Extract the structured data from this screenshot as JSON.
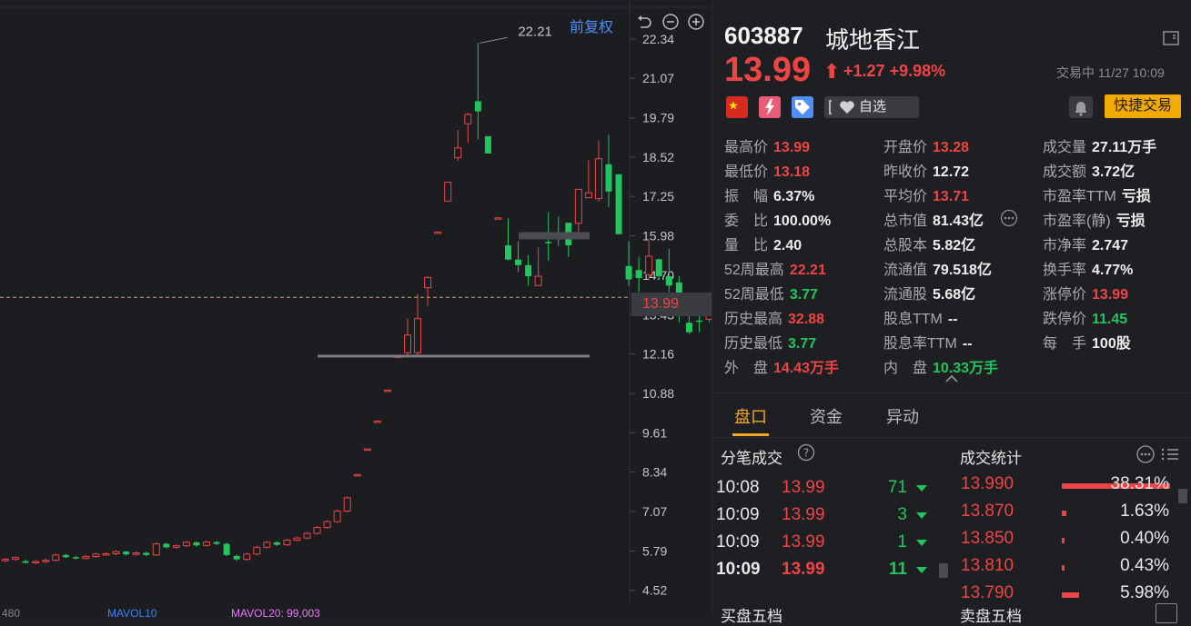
{
  "chart": {
    "adjust_label": "前复权",
    "price_axis": [
      "22.34",
      "21.07",
      "19.79",
      "18.52",
      "17.25",
      "15.98",
      "14.70",
      "13.43",
      "12.16",
      "10.88",
      "9.61",
      "8.34",
      "7.07",
      "5.79",
      "4.52"
    ],
    "annotation_high": "22.21",
    "current_price_tag": "13.99",
    "bottom_legend": {
      "vol": "480",
      "mavol10": "MAVOL10",
      "mavol20": "MAVOL20: 99,003"
    },
    "chart_data": {
      "type": "candlestick",
      "candles": [
        [
          5.48,
          5.52,
          5.43,
          5.56
        ],
        [
          5.52,
          5.58,
          5.48,
          5.62
        ],
        [
          5.46,
          5.41,
          5.38,
          5.52
        ],
        [
          5.41,
          5.45,
          5.37,
          5.5
        ],
        [
          5.45,
          5.49,
          5.4,
          5.55
        ],
        [
          5.49,
          5.66,
          5.46,
          5.71
        ],
        [
          5.66,
          5.59,
          5.56,
          5.7
        ],
        [
          5.59,
          5.55,
          5.52,
          5.64
        ],
        [
          5.55,
          5.61,
          5.52,
          5.66
        ],
        [
          5.61,
          5.69,
          5.57,
          5.74
        ],
        [
          5.69,
          5.7,
          5.65,
          5.75
        ],
        [
          5.7,
          5.77,
          5.66,
          5.82
        ],
        [
          5.77,
          5.68,
          5.64,
          5.8
        ],
        [
          5.68,
          5.73,
          5.64,
          5.78
        ],
        [
          5.73,
          5.66,
          5.62,
          5.77
        ],
        [
          5.66,
          6.02,
          5.63,
          6.08
        ],
        [
          6.02,
          5.91,
          5.87,
          6.06
        ],
        [
          5.91,
          5.96,
          5.86,
          6.01
        ],
        [
          5.96,
          6.07,
          5.92,
          6.12
        ],
        [
          6.07,
          5.97,
          5.93,
          6.1
        ],
        [
          5.97,
          6.08,
          5.93,
          6.13
        ],
        [
          6.08,
          6.02,
          5.98,
          6.12
        ],
        [
          6.02,
          5.66,
          5.62,
          6.06
        ],
        [
          5.63,
          5.52,
          5.47,
          5.68
        ],
        [
          5.52,
          5.69,
          5.48,
          5.74
        ],
        [
          5.69,
          5.91,
          5.65,
          5.96
        ],
        [
          5.91,
          6.07,
          5.87,
          6.12
        ],
        [
          6.07,
          5.99,
          5.95,
          6.11
        ],
        [
          5.99,
          6.14,
          5.95,
          6.19
        ],
        [
          6.14,
          6.21,
          6.1,
          6.26
        ],
        [
          6.21,
          6.36,
          6.17,
          6.41
        ],
        [
          6.36,
          6.55,
          6.32,
          6.6
        ],
        [
          6.55,
          6.74,
          6.51,
          6.79
        ],
        [
          6.74,
          7.08,
          6.7,
          7.13
        ],
        [
          7.08,
          7.51,
          7.04,
          7.56
        ],
        [
          8.26,
          8.26,
          8.26,
          8.26
        ],
        [
          9.09,
          9.09,
          9.09,
          9.09
        ],
        [
          9.99,
          9.99,
          9.99,
          9.99
        ],
        [
          10.99,
          10.99,
          10.99,
          10.99
        ],
        [
          12.09,
          12.09,
          12.09,
          12.09
        ],
        [
          12.2,
          12.77,
          12.09,
          13.3
        ],
        [
          12.2,
          13.3,
          12.09,
          14.1
        ],
        [
          14.3,
          14.63,
          13.7,
          14.67
        ],
        [
          16.1,
          16.1,
          16.1,
          16.1
        ],
        [
          17.1,
          17.71,
          17.1,
          17.71
        ],
        [
          18.5,
          18.82,
          18.4,
          19.4
        ],
        [
          19.6,
          19.9,
          18.98,
          19.95
        ],
        [
          20.33,
          20.0,
          19.1,
          22.21
        ],
        [
          19.2,
          18.64,
          18.64,
          19.08
        ],
        [
          16.56,
          16.56,
          16.56,
          16.56
        ],
        [
          15.67,
          15.21,
          15.19,
          16.54
        ],
        [
          15.21,
          15.03,
          14.81,
          15.8
        ],
        [
          15.03,
          14.67,
          14.37,
          15.35
        ],
        [
          14.37,
          14.67,
          14.37,
          15.6
        ],
        [
          15.78,
          15.74,
          15.18,
          16.74
        ],
        [
          16.03,
          15.87,
          15.65,
          16.6
        ],
        [
          16.4,
          15.67,
          15.29,
          16.4
        ],
        [
          16.38,
          17.48,
          15.99,
          17.48
        ],
        [
          17.21,
          17.37,
          17.22,
          18.42
        ],
        [
          17.18,
          18.47,
          17.08,
          19.06
        ],
        [
          18.29,
          17.41,
          16.9,
          19.24
        ],
        [
          17.97,
          16.03,
          16.03,
          17.97
        ],
        [
          15.0,
          14.57,
          14.37,
          15.8
        ],
        [
          14.87,
          14.61,
          14.17,
          15.3
        ],
        [
          14.72,
          15.32,
          14.55,
          15.82
        ],
        [
          15.22,
          14.67,
          14.56,
          15.24
        ],
        [
          14.67,
          14.37,
          14.16,
          15.56
        ],
        [
          14.47,
          13.67,
          13.17,
          14.67
        ],
        [
          13.17,
          12.86,
          12.8,
          13.87
        ],
        [
          13.24,
          13.2,
          12.86,
          13.48
        ],
        [
          13.28,
          13.99,
          13.18,
          13.99
        ]
      ],
      "reference_lines": [
        {
          "label": "support",
          "value": 12.09
        },
        {
          "label": "resistance",
          "value": 15.98
        }
      ],
      "y_range": [
        4.1,
        23.6
      ],
      "current_price": 13.99,
      "colors": {
        "up": "#ef4444",
        "down": "#22c55e",
        "line": "#7a7c82"
      }
    }
  },
  "quote": {
    "code": "603887",
    "name": "城地香江",
    "last_price": "13.99",
    "arrow": "⬆",
    "change": "+1.27",
    "change_pct": "+9.98%",
    "status": "交易中 11/27 10:09",
    "badges": [
      "CN-flag-icon",
      "lightning-icon",
      "tag-icon",
      "note-icon"
    ],
    "watch_label": "自选",
    "quick_trade_label": "快捷交易",
    "stats": [
      [
        {
          "k": "最高价",
          "v": "13.99",
          "c": "red"
        },
        {
          "k": "开盘价",
          "v": "13.28",
          "c": "red"
        },
        {
          "k": "成交量",
          "v": "27.11万手",
          "c": "white"
        }
      ],
      [
        {
          "k": "最低价",
          "v": "13.18",
          "c": "red"
        },
        {
          "k": "昨收价",
          "v": "12.72",
          "c": "white"
        },
        {
          "k": "成交额",
          "v": "3.72亿",
          "c": "white"
        }
      ],
      [
        {
          "k": "振　幅",
          "v": "6.37%",
          "c": "white"
        },
        {
          "k": "平均价",
          "v": "13.71",
          "c": "red"
        },
        {
          "k": "市盈率TTM",
          "v": "亏损",
          "c": "white"
        }
      ],
      [
        {
          "k": "委　比",
          "v": "100.00%",
          "c": "white"
        },
        {
          "k": "总市值",
          "v": "81.43亿",
          "c": "white"
        },
        {
          "k": "市盈率(静)",
          "v": "亏损",
          "c": "white"
        }
      ],
      [
        {
          "k": "量　比",
          "v": "2.40",
          "c": "white"
        },
        {
          "k": "总股本",
          "v": "5.82亿",
          "c": "white"
        },
        {
          "k": "市净率",
          "v": "2.747",
          "c": "white"
        }
      ],
      [
        {
          "k": "52周最高",
          "v": "22.21",
          "c": "red"
        },
        {
          "k": "流通值",
          "v": "79.518亿",
          "c": "white"
        },
        {
          "k": "换手率",
          "v": "4.77%",
          "c": "white"
        }
      ],
      [
        {
          "k": "52周最低",
          "v": "3.77",
          "c": "green"
        },
        {
          "k": "流通股",
          "v": "5.68亿",
          "c": "white"
        },
        {
          "k": "涨停价",
          "v": "13.99",
          "c": "red"
        }
      ],
      [
        {
          "k": "历史最高",
          "v": "32.88",
          "c": "red"
        },
        {
          "k": "股息TTM",
          "v": "--",
          "c": "white"
        },
        {
          "k": "跌停价",
          "v": "11.45",
          "c": "green"
        }
      ],
      [
        {
          "k": "历史最低",
          "v": "3.77",
          "c": "green"
        },
        {
          "k": "股息率TTM",
          "v": "--",
          "c": "white"
        },
        {
          "k": "每　手",
          "v": "100股",
          "c": "white"
        }
      ],
      [
        {
          "k": "外　盘",
          "v": "14.43万手",
          "c": "red"
        },
        {
          "k": "内　盘",
          "v": "10.33万手",
          "c": "green"
        }
      ]
    ],
    "tabs": [
      "盘口",
      "资金",
      "异动"
    ],
    "ticks_title": "分笔成交",
    "ticks": [
      {
        "time": "10:08",
        "price": "13.99",
        "qty": "11"
      },
      {
        "time": "10:08",
        "price": "13.99",
        "qty": "71"
      },
      {
        "time": "10:09",
        "price": "13.99",
        "qty": "3"
      },
      {
        "time": "10:09",
        "price": "13.99",
        "qty": "1"
      },
      {
        "time": "10:09",
        "price": "13.99",
        "qty": "11"
      }
    ],
    "dist_title": "成交统计",
    "dist": [
      {
        "price": "13.990",
        "pct": "38.31%",
        "share": 0.3831
      },
      {
        "price": "13.870",
        "pct": "1.63%",
        "share": 0.0163
      },
      {
        "price": "13.850",
        "pct": "0.40%",
        "share": 0.004
      },
      {
        "price": "13.810",
        "pct": "0.43%",
        "share": 0.0043
      },
      {
        "price": "13.790",
        "pct": "5.98%",
        "share": 0.0598
      }
    ],
    "buy_five": "买盘五档",
    "sell_five": "卖盘五档"
  }
}
